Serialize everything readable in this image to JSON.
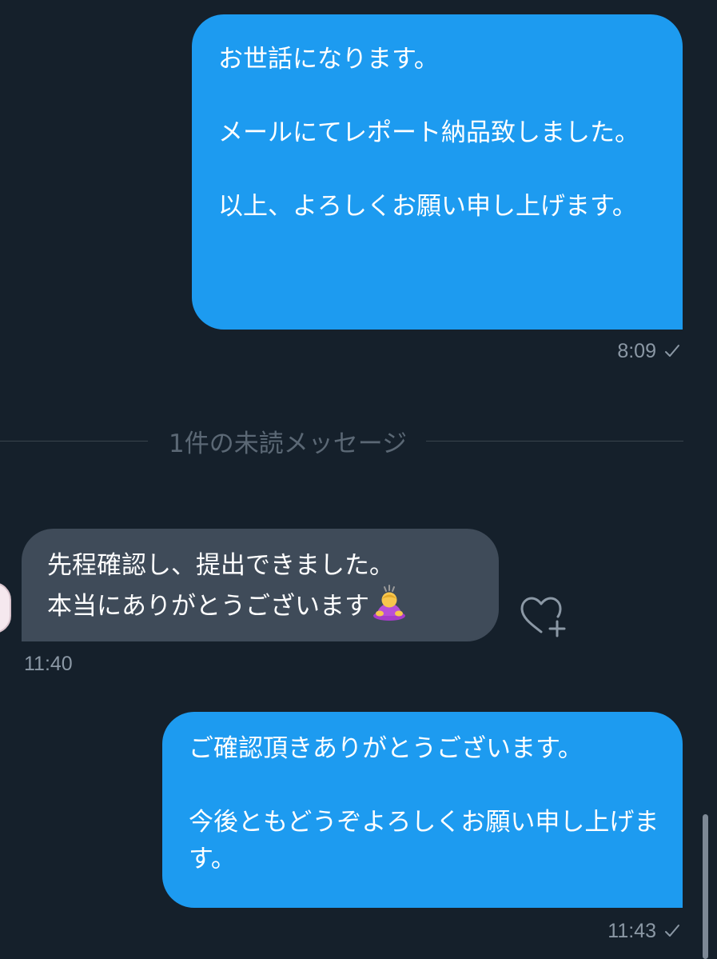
{
  "messages": [
    {
      "direction": "outgoing",
      "text": "お世話になります。\n\nメールにてレポート納品致しました。\n\n以上、よろしくお願い申し上げます。",
      "time": "8:09"
    },
    {
      "direction": "incoming",
      "line1": "先程確認し、提出できました。",
      "line2": "本当にありがとうございます",
      "emoji": "person-bowing",
      "time": "11:40"
    },
    {
      "direction": "outgoing",
      "text": "ご確認頂きありがとうございます。\n\n今後ともどうぞよろしくお願い申し上げます。",
      "time": "11:43"
    }
  ],
  "divider": {
    "text": "1件の未読メッセージ"
  },
  "icons": {
    "read_check": "check-icon",
    "reaction": "heart-plus-icon",
    "avatar": "avatar"
  },
  "colors": {
    "background": "#15202b",
    "outgoing_bubble": "#1d9bf0",
    "incoming_bubble": "#3f4b59",
    "meta_text": "#8b98a5",
    "divider_text": "#5b6875"
  }
}
